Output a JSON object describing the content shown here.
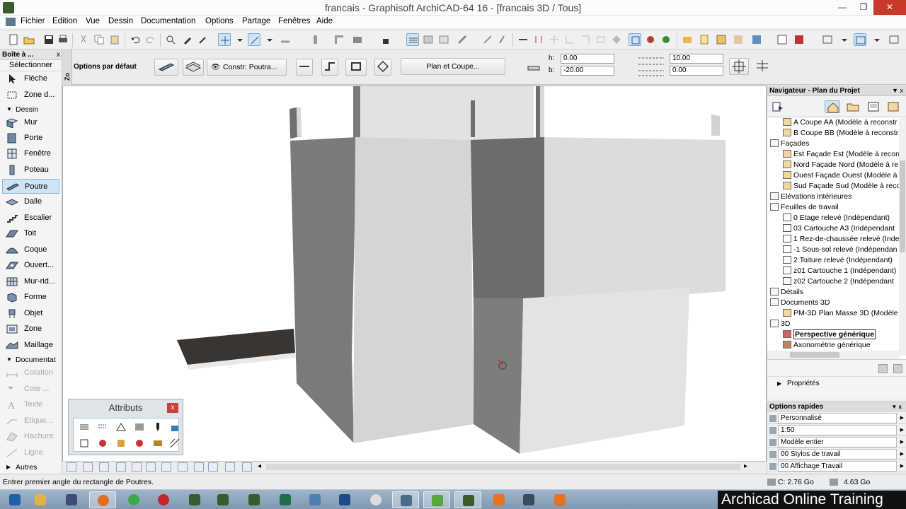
{
  "window": {
    "title": "francais - Graphisoft ArchiCAD-64 16 - [francais 3D / Tous]",
    "minimize": "—",
    "maximize": "❐",
    "close": "✕"
  },
  "menu": [
    "Fichier",
    "Edition",
    "Vue",
    "Dessin",
    "Documentation",
    "Options",
    "Partage",
    "Fenêtres",
    "Aide"
  ],
  "toolbox": {
    "title": "Boîte à ...",
    "close": "x",
    "select_label": "Sélectionner",
    "items": [
      {
        "label": "Flèche",
        "icon": "arrow-icon"
      },
      {
        "label": "Zone d...",
        "icon": "marquee-icon"
      }
    ],
    "group_dessin": "Dessin",
    "dessin_items": [
      {
        "label": "Mur",
        "icon": "wall-icon"
      },
      {
        "label": "Porte",
        "icon": "door-icon"
      },
      {
        "label": "Fenêtre",
        "icon": "window-icon"
      },
      {
        "label": "Poteau",
        "icon": "column-icon"
      },
      {
        "label": "Poutre",
        "icon": "beam-icon",
        "active": true
      },
      {
        "label": "Dalle",
        "icon": "slab-icon"
      },
      {
        "label": "Escalier",
        "icon": "stair-icon"
      },
      {
        "label": "Toit",
        "icon": "roof-icon"
      },
      {
        "label": "Coque",
        "icon": "shell-icon"
      },
      {
        "label": "Ouvert...",
        "icon": "skylight-icon"
      },
      {
        "label": "Mur-rid...",
        "icon": "curtain-wall-icon"
      },
      {
        "label": "Forme",
        "icon": "morph-icon"
      },
      {
        "label": "Objet",
        "icon": "object-icon"
      },
      {
        "label": "Zone",
        "icon": "zone-icon"
      },
      {
        "label": "Maillage",
        "icon": "mesh-icon"
      }
    ],
    "group_doc": "Documentat",
    "doc_items": [
      {
        "label": "Cotation",
        "icon": "dimension-icon"
      },
      {
        "label": "Cote ...",
        "icon": "level-dimension-icon"
      },
      {
        "label": "Texte",
        "icon": "text-icon"
      },
      {
        "label": "Etique...",
        "icon": "label-icon"
      },
      {
        "label": "Hachure",
        "icon": "fill-icon"
      },
      {
        "label": "Ligne",
        "icon": "line-icon"
      }
    ],
    "group_other": "Autres"
  },
  "infobox": {
    "vertical_tab": "Zo",
    "default_options": "Options par défaut",
    "constr_label": "Constr: Poutra...",
    "plan_coupe": "Plan et Coupe...",
    "h_label": "h:",
    "b_label": "b:",
    "h_value": "0.00",
    "b_value": "-20.00",
    "right_top": "10.00",
    "right_bottom": "0.00"
  },
  "attributes_palette": {
    "title": "Attributs",
    "close": "x"
  },
  "navigator": {
    "title": "Navigateur - Plan du Projet",
    "rows": [
      {
        "text": "A Coupe AA (Modèle à reconstr",
        "indent": 2,
        "icon": "section-icon"
      },
      {
        "text": "B Coupe BB (Modèle à reconstr",
        "indent": 2,
        "icon": "section-icon"
      },
      {
        "text": "Façades",
        "indent": 1,
        "icon": "folder-icon"
      },
      {
        "text": "Est Façade Est (Modèle à recon",
        "indent": 2,
        "icon": "elevation-icon"
      },
      {
        "text": "Nord Façade Nord (Modèle à re",
        "indent": 2,
        "icon": "elevation-icon"
      },
      {
        "text": "Ouest Façade Ouest (Modèle à",
        "indent": 2,
        "icon": "elevation-icon"
      },
      {
        "text": "Sud Façade Sud (Modèle à reco",
        "indent": 2,
        "icon": "elevation-icon"
      },
      {
        "text": "Elévations intérieures",
        "indent": 1,
        "icon": "folder-icon"
      },
      {
        "text": "Feuilles de travail",
        "indent": 1,
        "icon": "folder-icon"
      },
      {
        "text": "0 Etage relevé (Indépendant)",
        "indent": 2,
        "icon": "worksheet-icon"
      },
      {
        "text": "03 Cartouche A3 (Indépendant",
        "indent": 2,
        "icon": "worksheet-icon"
      },
      {
        "text": "1 Rez-de-chaussée relevé (Inde",
        "indent": 2,
        "icon": "worksheet-icon"
      },
      {
        "text": "-1 Sous-sol relevé (Indépendan",
        "indent": 2,
        "icon": "worksheet-icon"
      },
      {
        "text": "2 Toiture relevé (Indépendant)",
        "indent": 2,
        "icon": "worksheet-icon"
      },
      {
        "text": "z01 Cartouche 1 (Indépendant)",
        "indent": 2,
        "icon": "worksheet-icon"
      },
      {
        "text": "z02 Cartouche 2 (Indépendant",
        "indent": 2,
        "icon": "worksheet-icon"
      },
      {
        "text": "Détails",
        "indent": 1,
        "icon": "folder-icon"
      },
      {
        "text": "Documents 3D",
        "indent": 1,
        "icon": "folder-icon"
      },
      {
        "text": "PM-3D Plan Masse 3D (Modèle à",
        "indent": 2,
        "icon": "document3d-icon"
      },
      {
        "text": "3D",
        "indent": 1,
        "icon": "folder-icon"
      },
      {
        "text": "Perspective générique",
        "indent": 2,
        "icon": "perspective-icon",
        "selected": true
      },
      {
        "text": "Axonométrie générique",
        "indent": 2,
        "icon": "axonometry-icon"
      }
    ],
    "properties": "Propriétés"
  },
  "quick_options": {
    "title": "Options rapides",
    "rows": [
      "Personnalisé",
      "1:50",
      "Modèle entier",
      "00 Stylos de travail",
      "00 Affichage Travail"
    ]
  },
  "status": {
    "message": "Entrer premier angle du rectangle de Poutres.",
    "disk": "C: 2.76 Go",
    "memory": "4.63 Go"
  },
  "watermark": "Archicad Online Training"
}
